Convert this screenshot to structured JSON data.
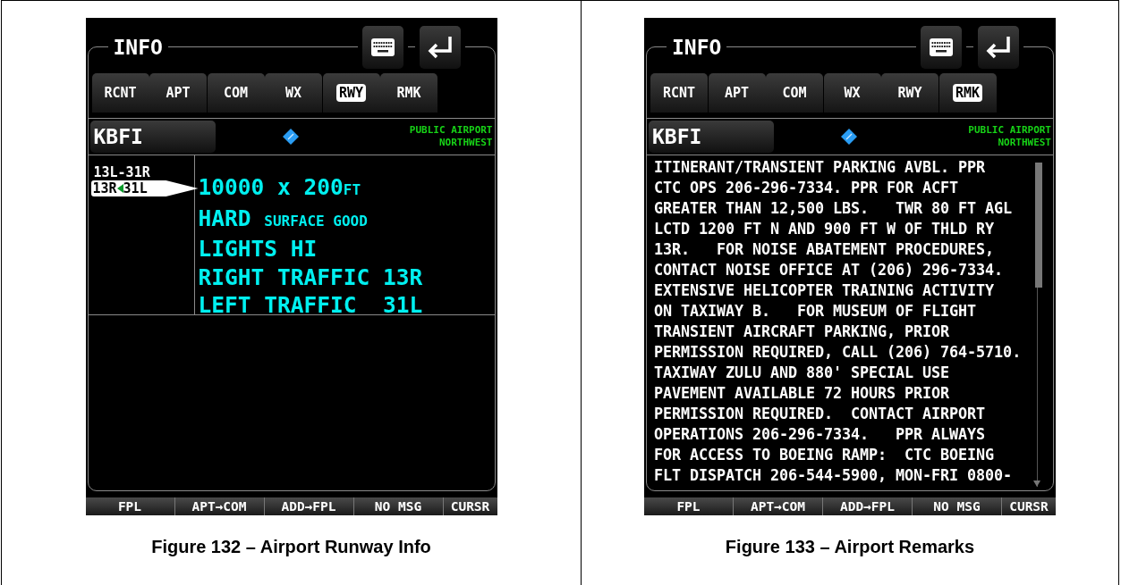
{
  "figures": [
    {
      "screen": {
        "kind": "runway",
        "title": "INFO",
        "tabs": [
          {
            "label": "RCNT",
            "selected": false
          },
          {
            "label": "APT",
            "selected": false
          },
          {
            "label": "COM",
            "selected": false
          },
          {
            "label": "WX",
            "selected": false
          },
          {
            "label": "RWY",
            "selected": true
          },
          {
            "label": "RMK",
            "selected": false
          }
        ],
        "ident": "KBFI",
        "airport_info": [
          "PUBLIC AIRPORT",
          "NORTHWEST"
        ],
        "runways": [
          {
            "kind": "plain",
            "label": "13L-31R",
            "selected": false
          },
          {
            "kind": "directional",
            "ends": [
              "13R",
              "31L"
            ],
            "selected": true
          }
        ],
        "details": [
          {
            "main": "10000 x 200",
            "small": "FT"
          },
          {
            "main": "HARD ",
            "small": "SURFACE GOOD"
          },
          {
            "main": "LIGHTS HI"
          },
          {
            "main": "RIGHT TRAFFIC 13R"
          },
          {
            "main": "LEFT TRAFFIC  31L"
          }
        ],
        "softkeys": [
          "FPL",
          "APT→COM",
          "ADD→FPL",
          "NO MSG",
          "CURSR"
        ]
      },
      "caption": "Figure 132 – Airport Runway Info"
    },
    {
      "screen": {
        "kind": "remarks",
        "title": "INFO",
        "tabs": [
          {
            "label": "RCNT",
            "selected": false
          },
          {
            "label": "APT",
            "selected": false
          },
          {
            "label": "COM",
            "selected": false
          },
          {
            "label": "WX",
            "selected": false
          },
          {
            "label": "RWY",
            "selected": false
          },
          {
            "label": "RMK",
            "selected": true
          }
        ],
        "ident": "KBFI",
        "airport_info": [
          "PUBLIC AIRPORT",
          "NORTHWEST"
        ],
        "remarks": [
          "ITINERANT/TRANSIENT PARKING AVBL. PPR",
          "CTC OPS 206-296-7334. PPR FOR ACFT",
          "GREATER THAN 12,500 LBS.   TWR 80 FT AGL",
          "LCTD 1200 FT N AND 900 FT W OF THLD RY",
          "13R.   FOR NOISE ABATEMENT PROCEDURES,",
          "CONTACT NOISE OFFICE AT (206) 296-7334.",
          "EXTENSIVE HELICOPTER TRAINING ACTIVITY",
          "ON TAXIWAY B.   FOR MUSEUM OF FLIGHT",
          "TRANSIENT AIRCRAFT PARKING, PRIOR",
          "PERMISSION REQUIRED, CALL (206) 764-5710.",
          "TAXIWAY ZULU AND 880' SPECIAL USE",
          "PAVEMENT AVAILABLE 72 HOURS PRIOR",
          "PERMISSION REQUIRED.  CONTACT AIRPORT",
          "OPERATIONS 206-296-7334.   PPR ALWAYS",
          "FOR ACCESS TO BOEING RAMP:  CTC BOEING",
          "FLT DISPATCH 206-544-5900, MON-FRI 0800-"
        ],
        "softkeys": [
          "FPL",
          "APT→COM",
          "ADD→FPL",
          "NO MSG",
          "CURSR"
        ]
      },
      "caption": "Figure 133 – Airport Remarks"
    }
  ]
}
